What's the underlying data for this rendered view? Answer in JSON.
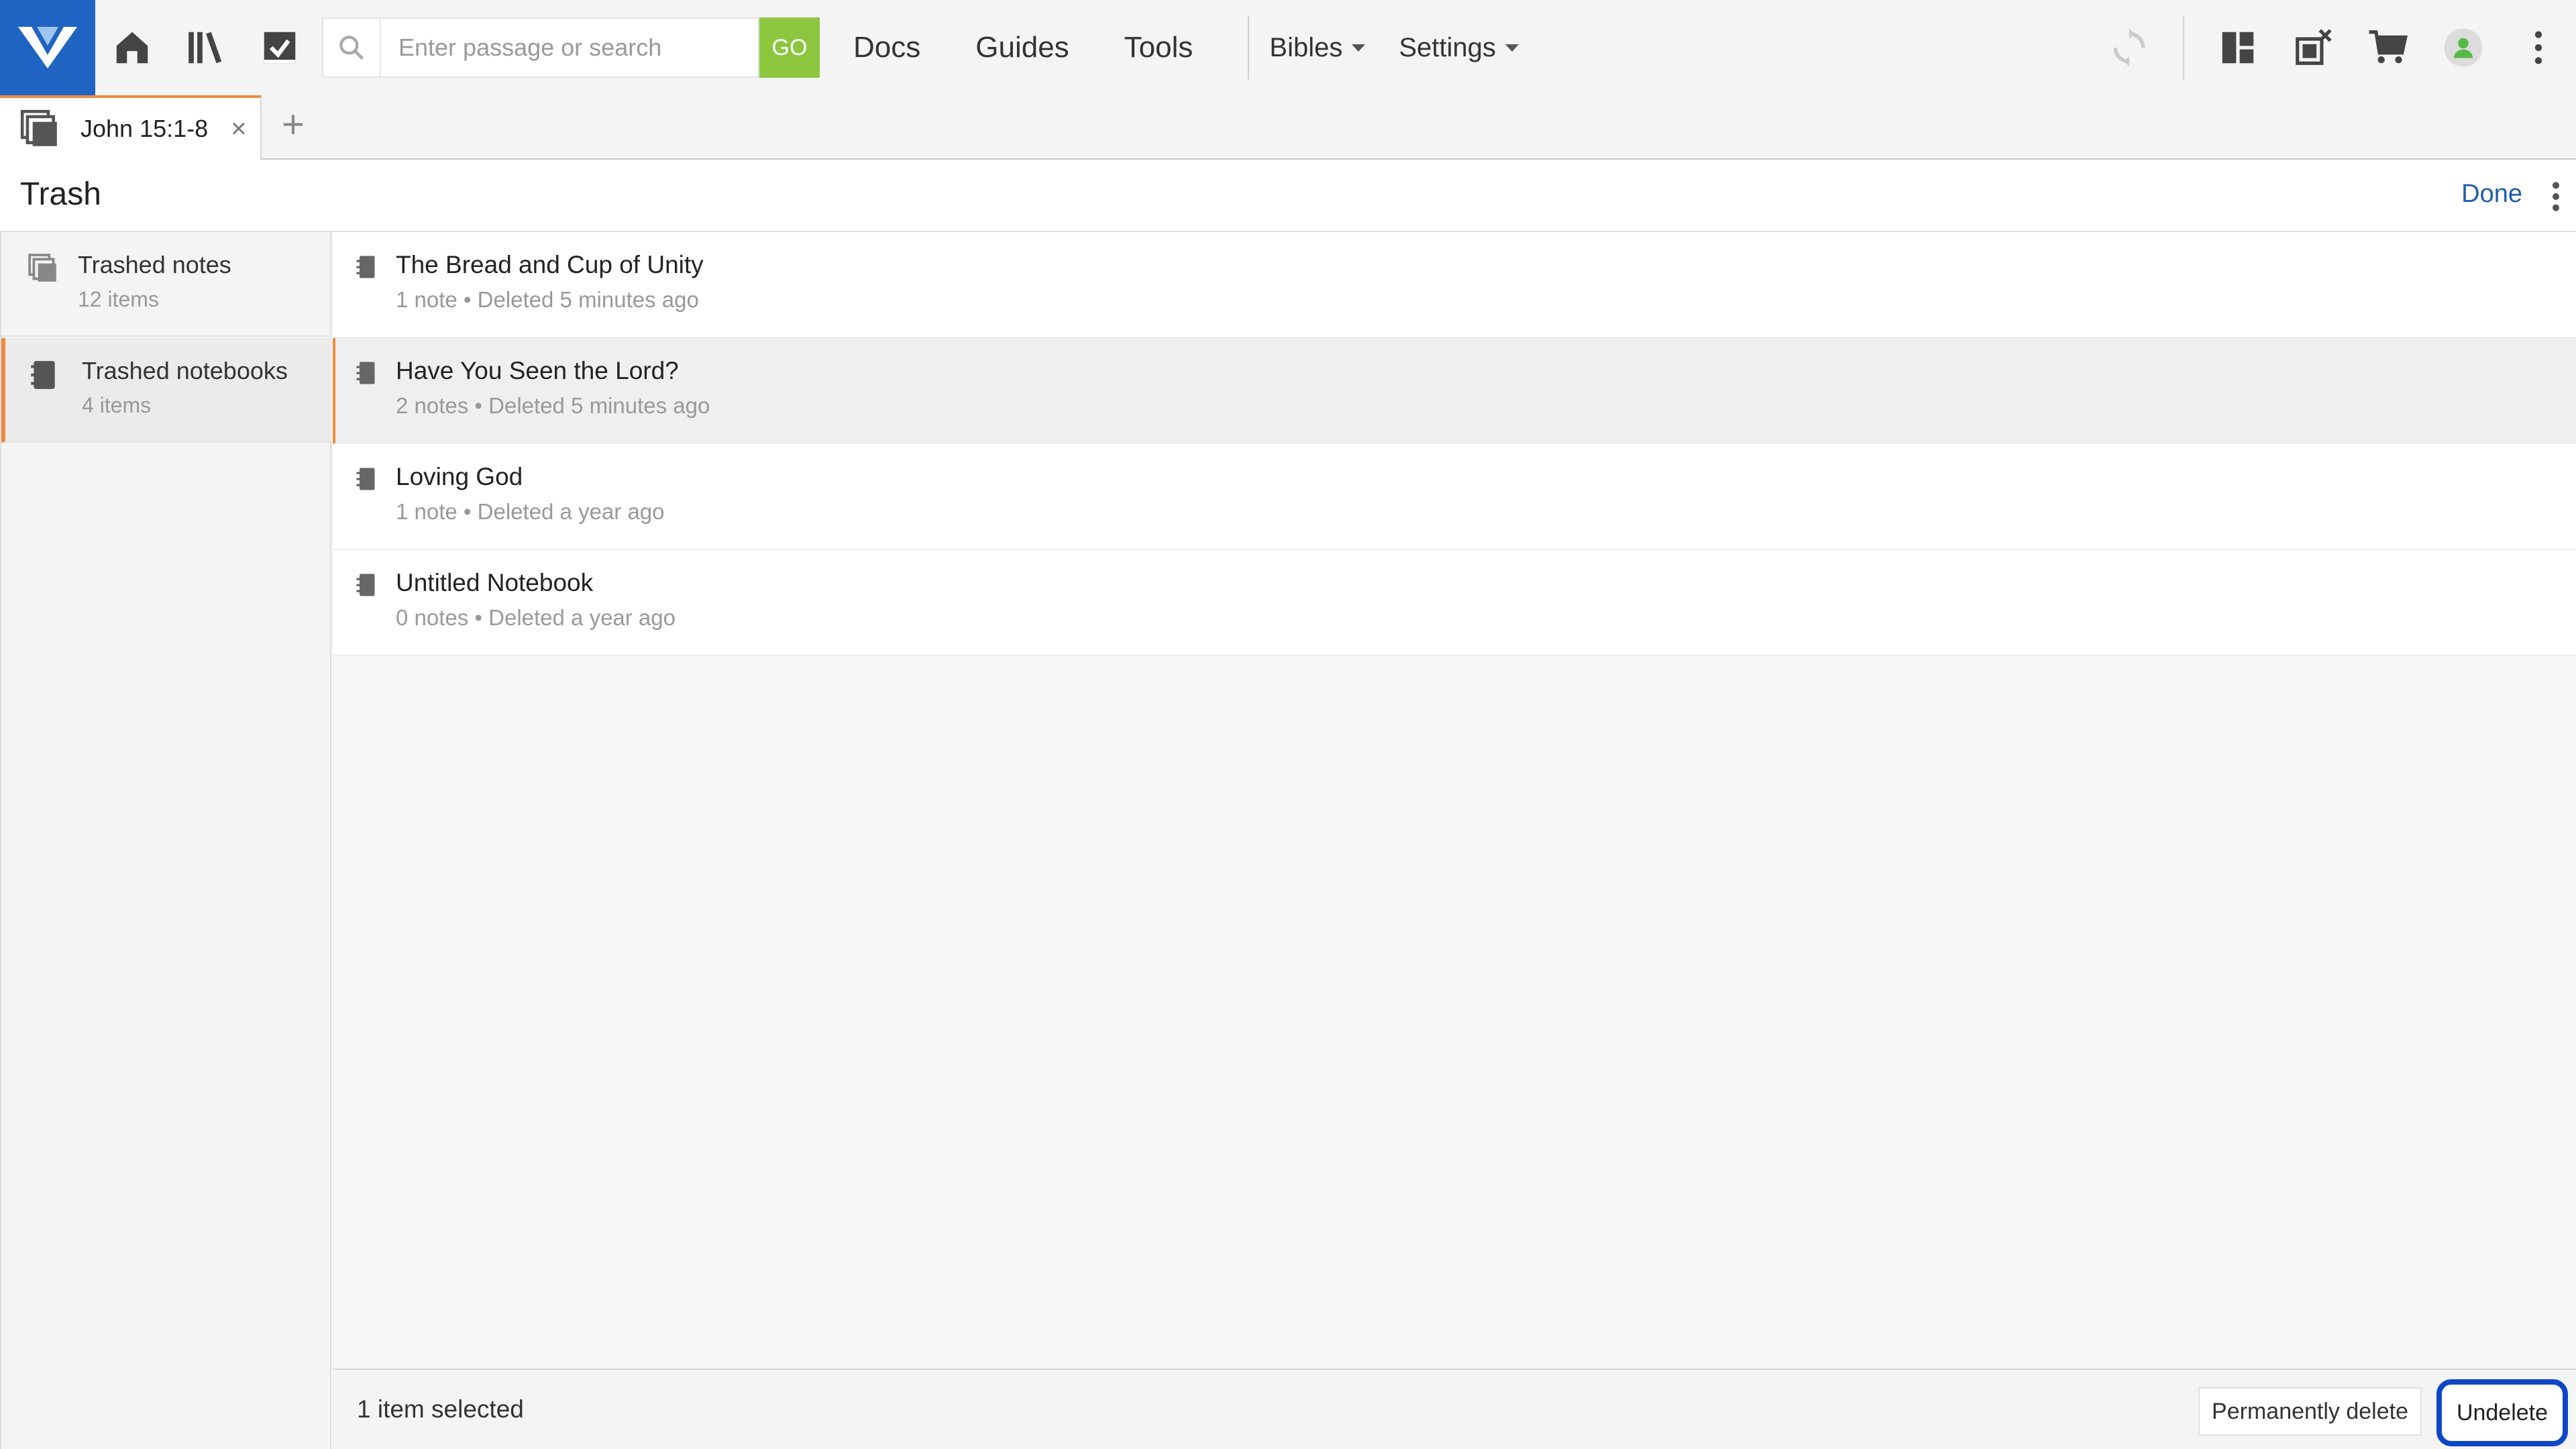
{
  "topbar": {
    "search_placeholder": "Enter passage or search",
    "go_label": "GO",
    "nav": [
      "Docs",
      "Guides",
      "Tools"
    ],
    "bibles_label": "Bibles",
    "settings_label": "Settings"
  },
  "tabs": [
    {
      "label": "John 15:1-8",
      "close": "×"
    }
  ],
  "new_tab_label": "+",
  "panel": {
    "title": "Trash",
    "done_label": "Done"
  },
  "sidebar": {
    "items": [
      {
        "title": "Trashed notes",
        "subtitle": "12 items",
        "icon": "notes-stack-icon"
      },
      {
        "title": "Trashed notebooks",
        "subtitle": "4 items",
        "icon": "notebook-icon"
      }
    ]
  },
  "list": {
    "rows": [
      {
        "title": "The Bread and Cup of Unity",
        "subtitle": "1 note • Deleted 5 minutes ago"
      },
      {
        "title": "Have You Seen the Lord?",
        "subtitle": "2 notes • Deleted 5 minutes ago"
      },
      {
        "title": "Loving God",
        "subtitle": "1 note • Deleted a year ago"
      },
      {
        "title": "Untitled Notebook",
        "subtitle": "0 notes • Deleted a year ago"
      }
    ]
  },
  "bottombar": {
    "selection_text": "1 item selected",
    "permanently_delete_label": "Permanently delete",
    "undelete_label": "Undelete"
  },
  "colors": {
    "brand_blue": "#1f64c2",
    "go_green": "#8cc63f",
    "accent_orange": "#ef8a3c",
    "link_blue": "#1f5fa8",
    "focus_ring": "#0d47c7"
  }
}
